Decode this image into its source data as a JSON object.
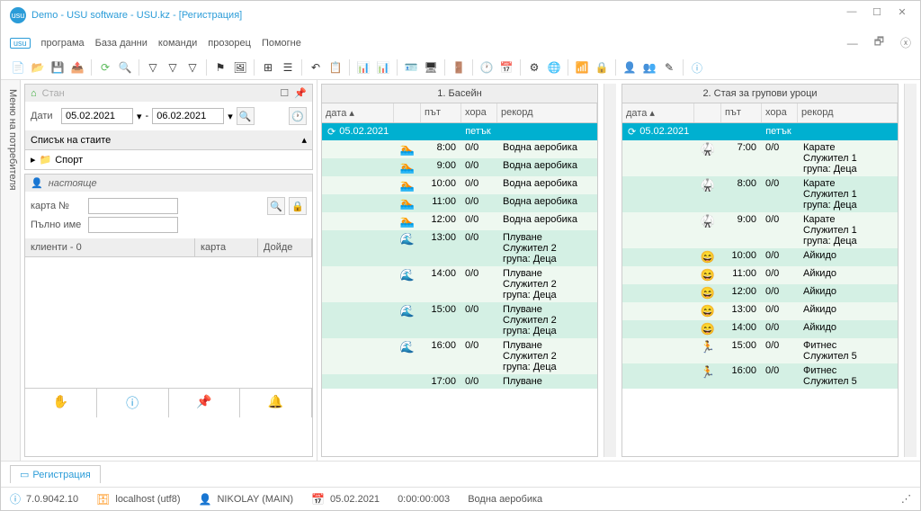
{
  "title": "Demo - USU software - USU.kz - [Регистрация]",
  "menu": {
    "program": "програма",
    "db": "База данни",
    "cmd": "команди",
    "win": "прозорец",
    "help": "Помогне"
  },
  "left": {
    "sidebar_label": "Меню на потребителя",
    "stan": "Стан",
    "date_label": "Дати",
    "date_from": "05.02.2021",
    "date_to": "06.02.2021",
    "rooms_label": "Списък на стаите",
    "room1": "Спорт",
    "now": "настояще",
    "card_label": "карта №",
    "fullname_label": "Пълно име",
    "clients": "клиенти - 0",
    "card_col": "карта",
    "came_col": "Дойде"
  },
  "sched1": {
    "title": "1. Басейн",
    "cols": {
      "date": "дата",
      "time": "път",
      "ppl": "хора",
      "rec": "рекорд"
    },
    "day": "05.02.2021",
    "dayname": "петък",
    "rows": [
      {
        "ico": "🏊",
        "t": "8:00",
        "p": "0/0",
        "r": "Водна аеробика"
      },
      {
        "ico": "🏊",
        "t": "9:00",
        "p": "0/0",
        "r": "Водна аеробика"
      },
      {
        "ico": "🏊",
        "t": "10:00",
        "p": "0/0",
        "r": "Водна аеробика"
      },
      {
        "ico": "🏊",
        "t": "11:00",
        "p": "0/0",
        "r": "Водна аеробика"
      },
      {
        "ico": "🏊",
        "t": "12:00",
        "p": "0/0",
        "r": "Водна аеробика"
      },
      {
        "ico": "🌊",
        "t": "13:00",
        "p": "0/0",
        "r": "Плуване\nСлужител 2\nгрупа: Деца"
      },
      {
        "ico": "🌊",
        "t": "14:00",
        "p": "0/0",
        "r": "Плуване\nСлужител 2\nгрупа: Деца"
      },
      {
        "ico": "🌊",
        "t": "15:00",
        "p": "0/0",
        "r": "Плуване\nСлужител 2\nгрупа: Деца"
      },
      {
        "ico": "🌊",
        "t": "16:00",
        "p": "0/0",
        "r": "Плуване\nСлужител 2\nгрупа: Деца"
      },
      {
        "ico": "",
        "t": "17:00",
        "p": "0/0",
        "r": "Плуване"
      }
    ]
  },
  "sched2": {
    "title": "2. Стая за групови уроци",
    "day": "05.02.2021",
    "dayname": "петък",
    "rows": [
      {
        "ico": "🥋",
        "t": "7:00",
        "p": "0/0",
        "r": "Карате\nСлужител 1\nгрупа: Деца"
      },
      {
        "ico": "🥋",
        "t": "8:00",
        "p": "0/0",
        "r": "Карате\nСлужител 1\nгрупа: Деца"
      },
      {
        "ico": "🥋",
        "t": "9:00",
        "p": "0/0",
        "r": "Карате\nСлужител 1\nгрупа: Деца"
      },
      {
        "ico": "😄",
        "t": "10:00",
        "p": "0/0",
        "r": "Айкидо"
      },
      {
        "ico": "😄",
        "t": "11:00",
        "p": "0/0",
        "r": "Айкидо"
      },
      {
        "ico": "😄",
        "t": "12:00",
        "p": "0/0",
        "r": "Айкидо"
      },
      {
        "ico": "😄",
        "t": "13:00",
        "p": "0/0",
        "r": "Айкидо"
      },
      {
        "ico": "😄",
        "t": "14:00",
        "p": "0/0",
        "r": "Айкидо"
      },
      {
        "ico": "🏃",
        "t": "15:00",
        "p": "0/0",
        "r": "Фитнес\nСлужител 5"
      },
      {
        "ico": "🏃",
        "t": "16:00",
        "p": "0/0",
        "r": "Фитнес\nСлужител 5"
      }
    ]
  },
  "tab": "Регистрация",
  "status": {
    "ver": "7.0.9042.10",
    "host": "localhost (utf8)",
    "user": "NIKOLAY (MAIN)",
    "date": "05.02.2021",
    "elapsed": "0:00:00:003",
    "activity": "Водна аеробика"
  }
}
